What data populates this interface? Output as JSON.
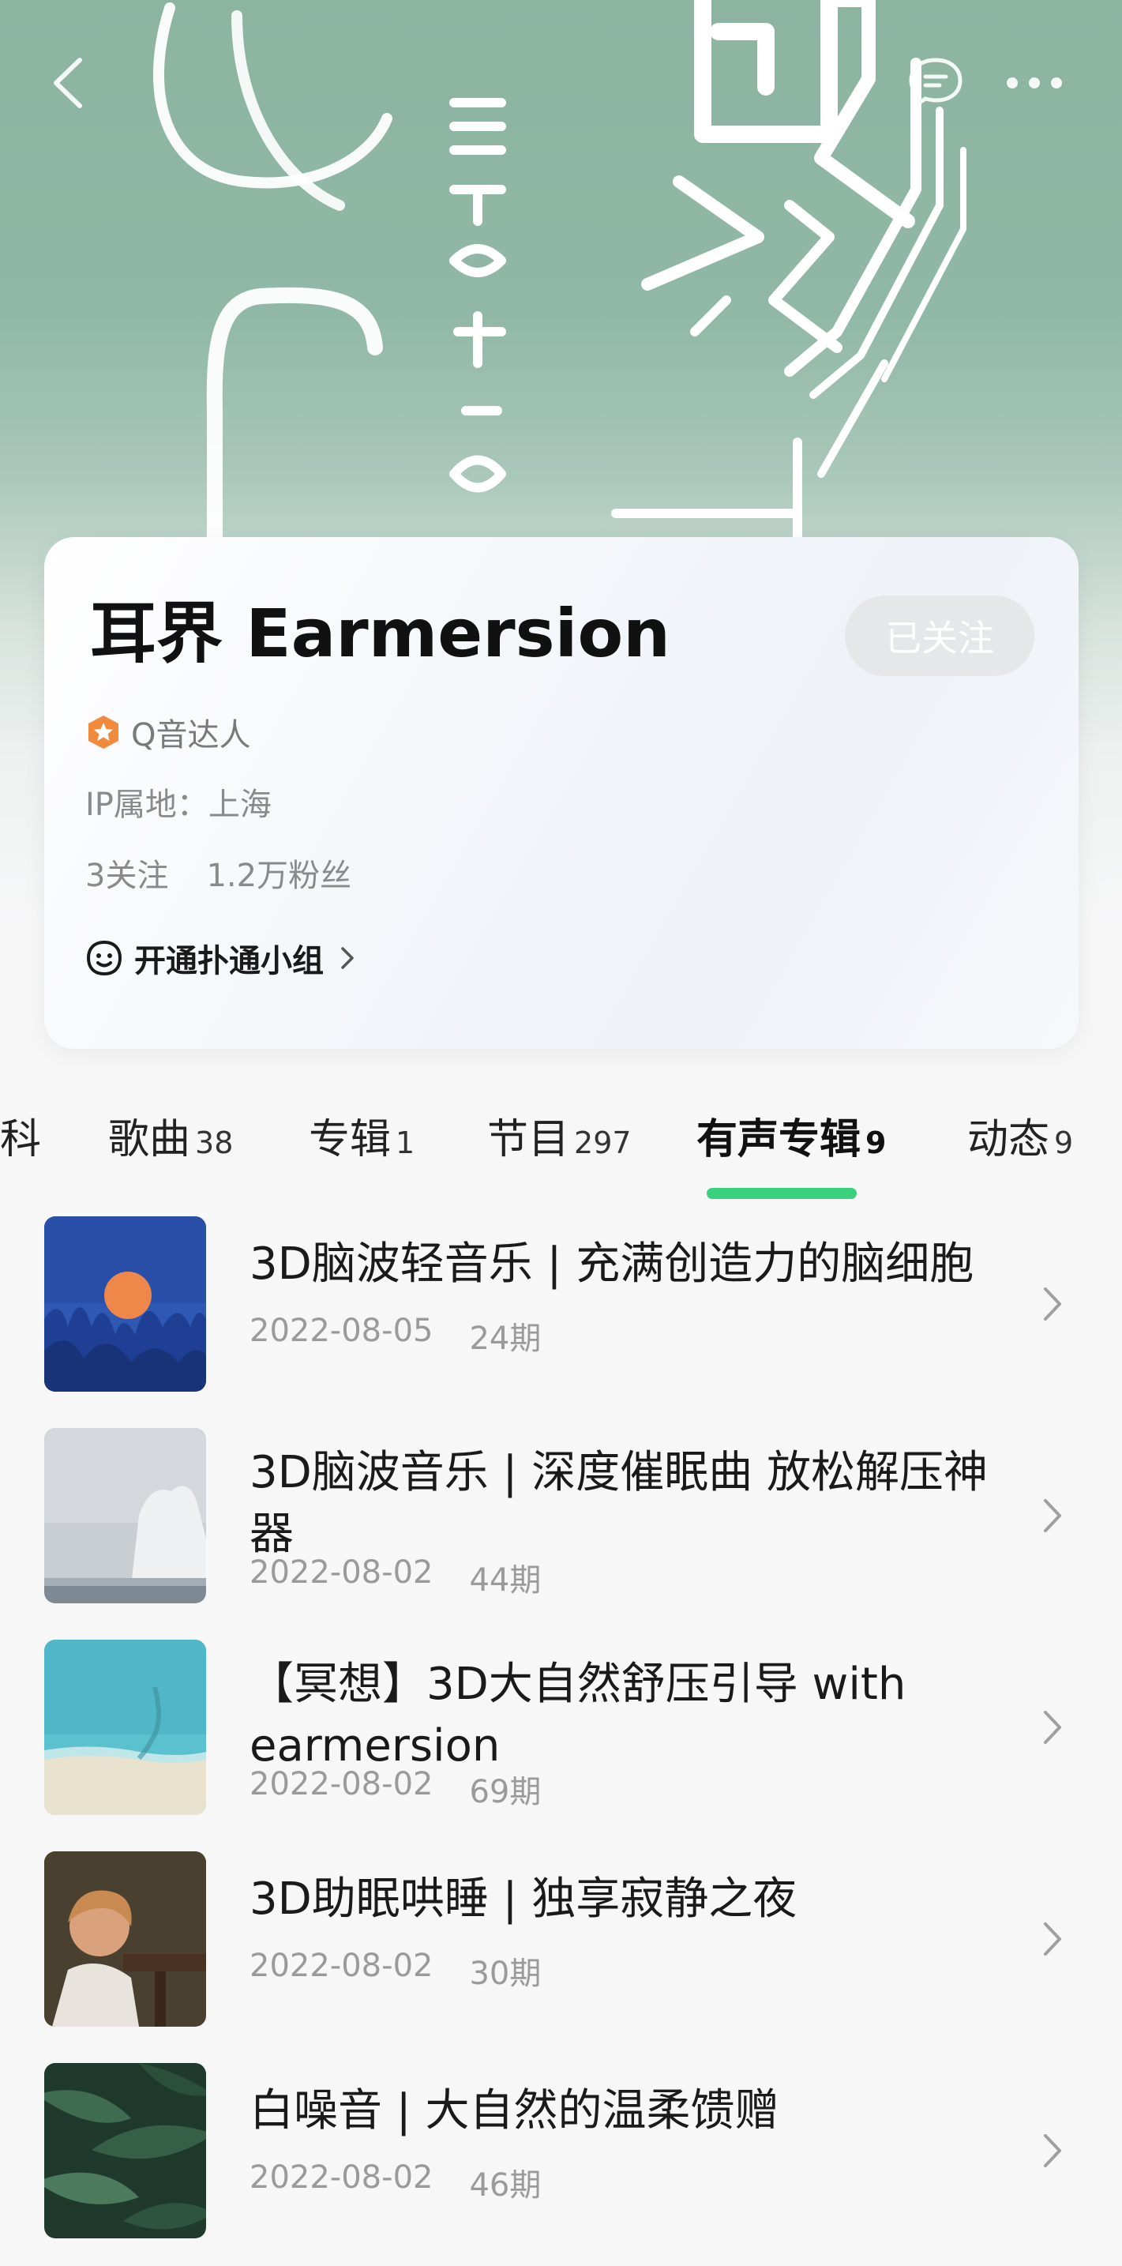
{
  "profile": {
    "name": "耳界 Earmersion",
    "follow_state": "已关注",
    "badge": "Q音达人",
    "ip_location": "IP属地：上海",
    "following": "3关注",
    "fans": "1.2万粉丝",
    "group_link": "开通扑通小组"
  },
  "tabs": [
    {
      "label": "科",
      "count": ""
    },
    {
      "label": "歌曲",
      "count": "38"
    },
    {
      "label": "专辑",
      "count": "1"
    },
    {
      "label": "节目",
      "count": "297"
    },
    {
      "label": "有声专辑",
      "count": "9",
      "active": true
    },
    {
      "label": "动态",
      "count": "9"
    }
  ],
  "albums": [
    {
      "title": "3D脑波轻音乐 | 充满创造力的脑细胞",
      "date": "2022-08-05",
      "episodes": "24期"
    },
    {
      "title": "3D脑波音乐 | 深度催眠曲 放松解压神器",
      "date": "2022-08-02",
      "episodes": "44期"
    },
    {
      "title": "【冥想】3D大自然舒压引导 with earmersion",
      "date": "2022-08-02",
      "episodes": "69期"
    },
    {
      "title": "3D助眠哄睡 | 独享寂静之夜",
      "date": "2022-08-02",
      "episodes": "30期"
    },
    {
      "title": "白噪音 | 大自然的温柔馈赠",
      "date": "2022-08-02",
      "episodes": "46期"
    }
  ],
  "colors": {
    "hero_green": "#8db3a1",
    "accent_green": "#3ad17c",
    "badge_orange": "#f08a3c"
  },
  "icons": {
    "back": "chevron-left-icon",
    "chat": "chat-bubble-icon",
    "more": "more-dots-icon",
    "badge": "star-badge-icon",
    "group": "smiley-icon",
    "chevron": "chevron-right-icon"
  }
}
